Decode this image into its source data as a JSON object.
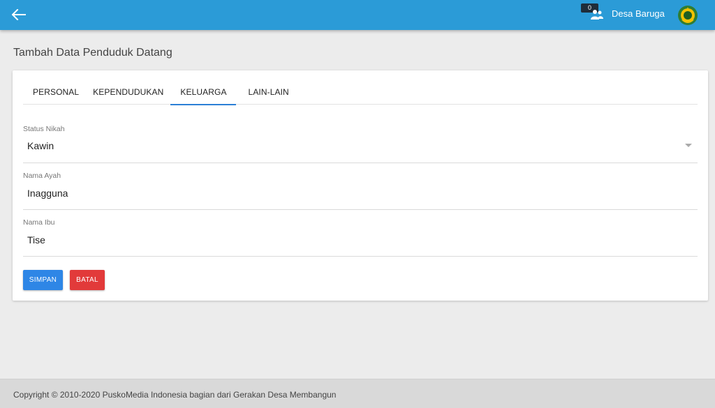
{
  "header": {
    "notification_count": "0",
    "user_name": "Desa Baruga",
    "brand_color": "#2b9bd7"
  },
  "page": {
    "title": "Tambah Data Penduduk Datang"
  },
  "tabs": [
    {
      "label": "PERSONAL",
      "active": false
    },
    {
      "label": "KEPENDUDUKAN",
      "active": false
    },
    {
      "label": "KELUARGA",
      "active": true
    },
    {
      "label": "LAIN-LAIN",
      "active": false
    }
  ],
  "form": {
    "status_nikah": {
      "label": "Status Nikah",
      "value": "Kawin"
    },
    "nama_ayah": {
      "label": "Nama Ayah",
      "value": "Inagguna"
    },
    "nama_ibu": {
      "label": "Nama Ibu",
      "value": "Tise"
    }
  },
  "buttons": {
    "save_label": "SIMPAN",
    "cancel_label": "BATAL",
    "save_color": "#2e86e6",
    "cancel_color": "#e23a3a"
  },
  "footer": {
    "text": "Copyright © 2010-2020 PuskoMedia Indonesia bagian dari Gerakan Desa Membangun"
  }
}
